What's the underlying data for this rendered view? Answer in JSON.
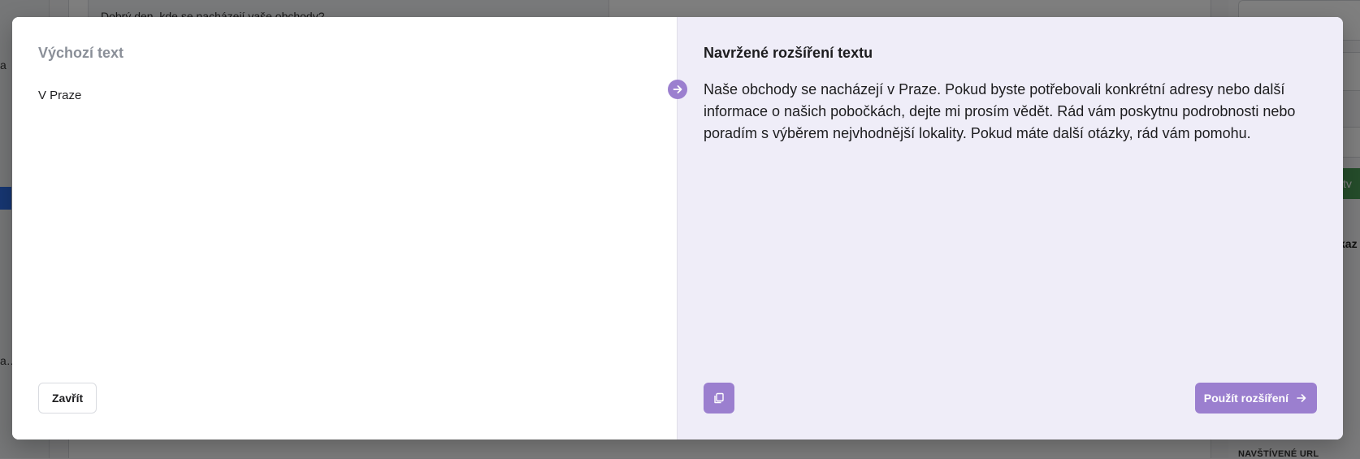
{
  "background": {
    "chat_preview": "Dobrý den, kde se nacházejí vaše obchody?",
    "left_snippets": [
      "a",
      "a…"
    ],
    "right_snippets": {
      "green_button": "ytv",
      "bold_text": "kaz",
      "section_label": "NAVŠTÍVENÉ URL"
    }
  },
  "modal": {
    "left": {
      "title": "Výchozí text",
      "text": "V Praze",
      "close_label": "Zavřít"
    },
    "right": {
      "title": "Navržené rozšíření textu",
      "text": "Naše obchody se nacházejí v Praze. Pokud byste potřebovali konkrétní adresy nebo další informace o našich pobočkách, dejte mi prosím vědět. Rád vám poskytnu podrobnosti nebo poradím s výběrem nejvhodnější lokality. Pokud máte další otázky, rád vám pomohu.",
      "apply_label": "Použít rozšíření",
      "copy_icon": "copy-icon",
      "apply_icon": "arrow-right-icon",
      "marker_icon": "arrow-right-icon"
    }
  },
  "colors": {
    "accent": "#9b7fcf",
    "right_pane_bg": "#efedf8",
    "overlay": "rgba(0,0,0,0.5)"
  }
}
